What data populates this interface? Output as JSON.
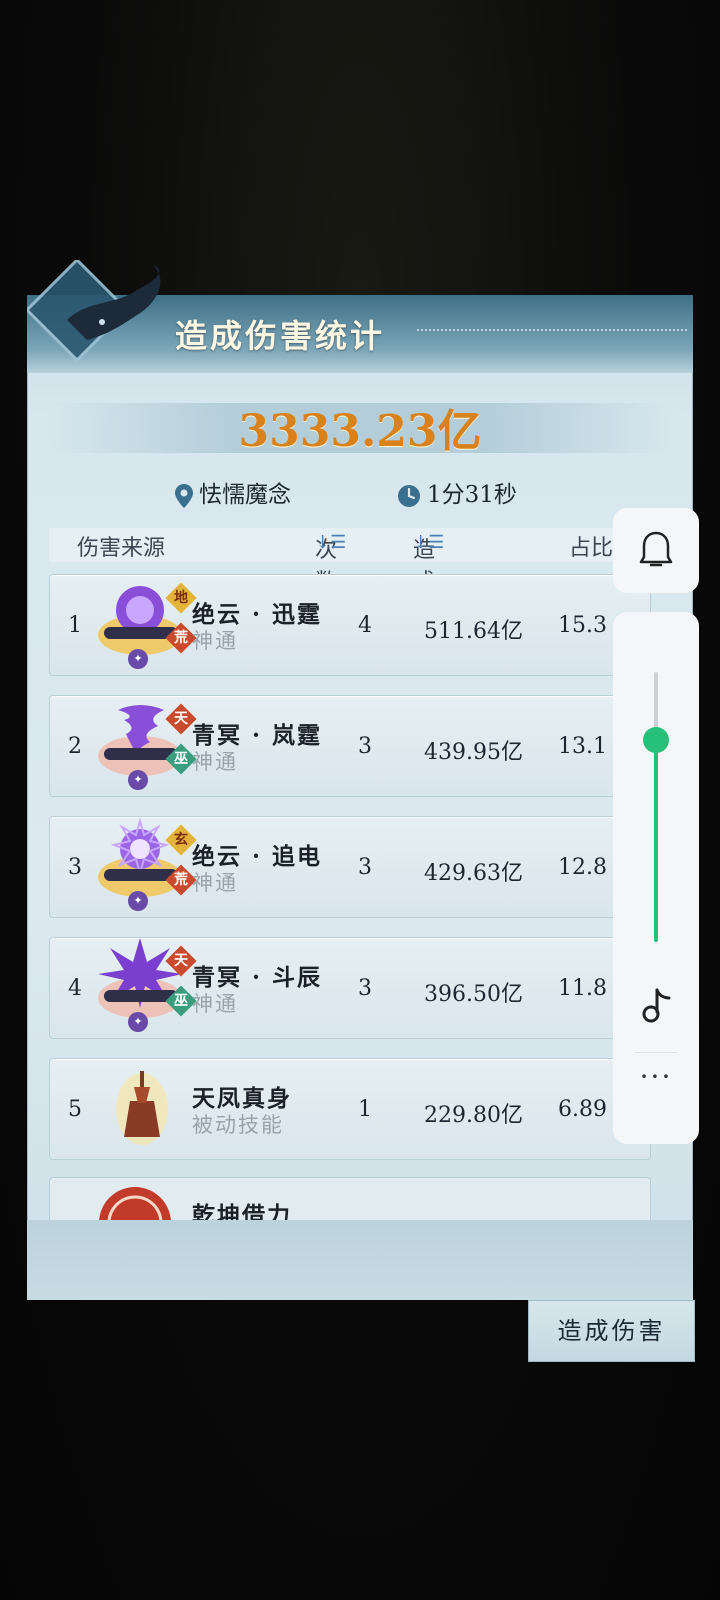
{
  "panel": {
    "title": "造成伤害统计",
    "total_damage": "3333.23亿",
    "target": "怯懦魔念",
    "duration": "1分31秒"
  },
  "table": {
    "headers": {
      "source": "伤害来源",
      "count": "次数",
      "damage": "造成伤害",
      "percent": "占比"
    },
    "rows": [
      {
        "rank": "1",
        "name": "绝云 · 迅霆",
        "kind": "神通",
        "count": "4",
        "damage": "511.64亿",
        "percent": "15.3",
        "badge_top": "地",
        "badge_bottom": "荒"
      },
      {
        "rank": "2",
        "name": "青冥 · 岚霆",
        "kind": "神通",
        "count": "3",
        "damage": "439.95亿",
        "percent": "13.1",
        "badge_top": "天",
        "badge_bottom": "巫"
      },
      {
        "rank": "3",
        "name": "绝云 · 追电",
        "kind": "神通",
        "count": "3",
        "damage": "429.63亿",
        "percent": "12.8",
        "badge_top": "玄",
        "badge_bottom": "荒"
      },
      {
        "rank": "4",
        "name": "青冥 · 斗辰",
        "kind": "神通",
        "count": "3",
        "damage": "396.50亿",
        "percent": "11.8",
        "badge_top": "天",
        "badge_bottom": "巫"
      },
      {
        "rank": "5",
        "name": "天凤真身",
        "kind": "被动技能",
        "count": "1",
        "damage": "229.80亿",
        "percent": "6.89",
        "badge_top": "",
        "badge_bottom": ""
      }
    ],
    "partial_row_name": "乾坤借力"
  },
  "side_tab": "造成伤害",
  "overlay": {
    "volume_level": 0.75,
    "icons": [
      "bell-icon",
      "music-note-icon",
      "more-icon"
    ]
  },
  "colors": {
    "accent_gold": "#d9821c",
    "slider_green": "#27c07a"
  }
}
